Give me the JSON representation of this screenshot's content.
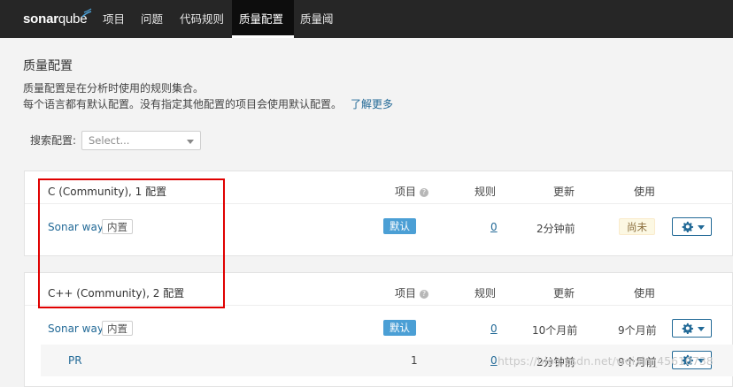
{
  "nav": {
    "logo_text_bold": "sonar",
    "logo_text_light": "qube",
    "items": [
      "项目",
      "问题",
      "代码规则",
      "质量配置",
      "质量阈"
    ],
    "active_index": 3
  },
  "page": {
    "title": "质量配置",
    "description_line1": "质量配置是在分析时使用的规则集合。",
    "description_line2": "每个语言都有默认配置。没有指定其他配置的项目会使用默认配置。",
    "learn_more": "了解更多"
  },
  "search": {
    "label": "搜索配置:",
    "placeholder": "Select..."
  },
  "columns": {
    "projects": "项目",
    "rules": "规则",
    "updated": "更新",
    "used": "使用",
    "help_icon": "question-icon"
  },
  "languages": [
    {
      "title": "C (Community), 1 配置",
      "profiles": [
        {
          "name": "Sonar way",
          "builtin": "内置",
          "projects": "默认",
          "rules": "0",
          "updated": "2分钟前",
          "used": "尚未"
        }
      ]
    },
    {
      "title": "C++ (Community), 2 配置",
      "profiles": [
        {
          "name": "Sonar way",
          "builtin": "内置",
          "projects": "默认",
          "rules": "0",
          "updated": "10个月前",
          "used": "9个月前"
        },
        {
          "name": "PR",
          "builtin": "",
          "projects": "1",
          "rules": "0",
          "updated": "2分钟前",
          "used": "9个月前"
        }
      ]
    }
  ],
  "watermark": "https://blog.csdn.net/weixin_45610738",
  "colors": {
    "topbar": "#262626",
    "link": "#236a97",
    "default_badge": "#4b9fd5",
    "highlight_box": "#e00000"
  }
}
